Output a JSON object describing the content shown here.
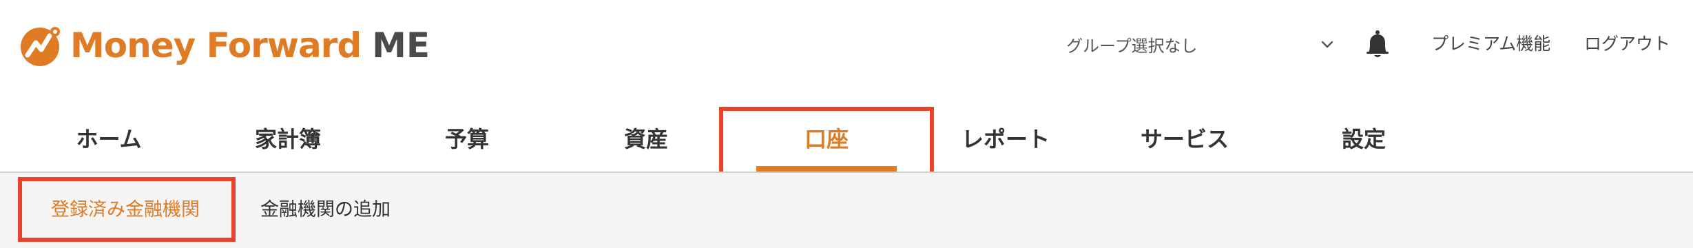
{
  "brand": {
    "name": "Money Forward",
    "suffix": "ME",
    "color": "#e07b25",
    "suffix_color": "#4a4a4a"
  },
  "header": {
    "group_select_label": "グループ選択なし",
    "bell_icon": "bell-icon",
    "premium_label": "プレミアム機能",
    "logout_label": "ログアウト"
  },
  "tabs": [
    {
      "label": "ホーム"
    },
    {
      "label": "家計簿"
    },
    {
      "label": "予算"
    },
    {
      "label": "資産"
    },
    {
      "label": "口座",
      "active": true
    },
    {
      "label": "レポート"
    },
    {
      "label": "サービス"
    },
    {
      "label": "設定"
    }
  ],
  "subnav": [
    {
      "label": "登録済み金融機関",
      "active": true
    },
    {
      "label": "金融機関の追加"
    }
  ],
  "colors": {
    "accent": "#e07b25",
    "highlight_box": "#e8442c",
    "subnav_bg": "#f5f5f5"
  }
}
